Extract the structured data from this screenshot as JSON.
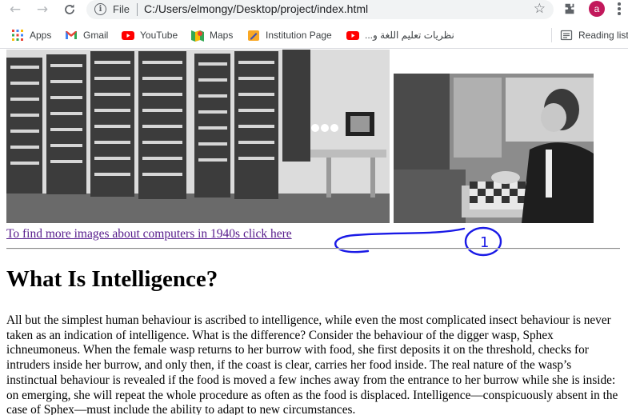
{
  "browser": {
    "file_label": "File",
    "url": "C:/Users/elmongy/Desktop/project/index.html",
    "avatar_letter": "a",
    "bookmarks": [
      {
        "label": "Apps",
        "icon": "apps-grid-icon"
      },
      {
        "label": "Gmail",
        "icon": "gmail-icon"
      },
      {
        "label": "YouTube",
        "icon": "youtube-icon"
      },
      {
        "label": "Maps",
        "icon": "maps-icon"
      },
      {
        "label": "Institution Page",
        "icon": "institution-icon"
      },
      {
        "label": "نظريات تعليم اللغة و...",
        "icon": "youtube-icon"
      }
    ],
    "reading_list_label": "Reading list",
    "colors": {
      "youtube": "#ff0000",
      "avatar": "#c2185b",
      "link_visited": "#551a8b"
    }
  },
  "page": {
    "images": [
      {
        "name": "eniac-computer-photo"
      },
      {
        "name": "man-playing-chess-photo"
      }
    ],
    "link_text": "To find more images about computers in 1940s click here",
    "annotation_text": "1",
    "heading": "What Is Intelligence?",
    "paragraph": "All but the simplest human behaviour is ascribed to intelligence, while even the most complicated insect behaviour is never taken as an indication of intelligence. What is the difference? Consider the behaviour of the digger wasp, Sphex ichneumoneus. When the female wasp returns to her burrow with food, she first deposits it on the threshold, checks for intruders inside her burrow, and only then, if the coast is clear, carries her food inside. The real nature of the wasp’s instinctual behaviour is revealed if the food is moved a few inches away from the entrance to her burrow while she is inside: on emerging, she will repeat the whole procedure as often as the food is displaced. Intelligence—conspicuously absent in the case of Sphex—must include the ability to adapt to new circumstances."
  }
}
